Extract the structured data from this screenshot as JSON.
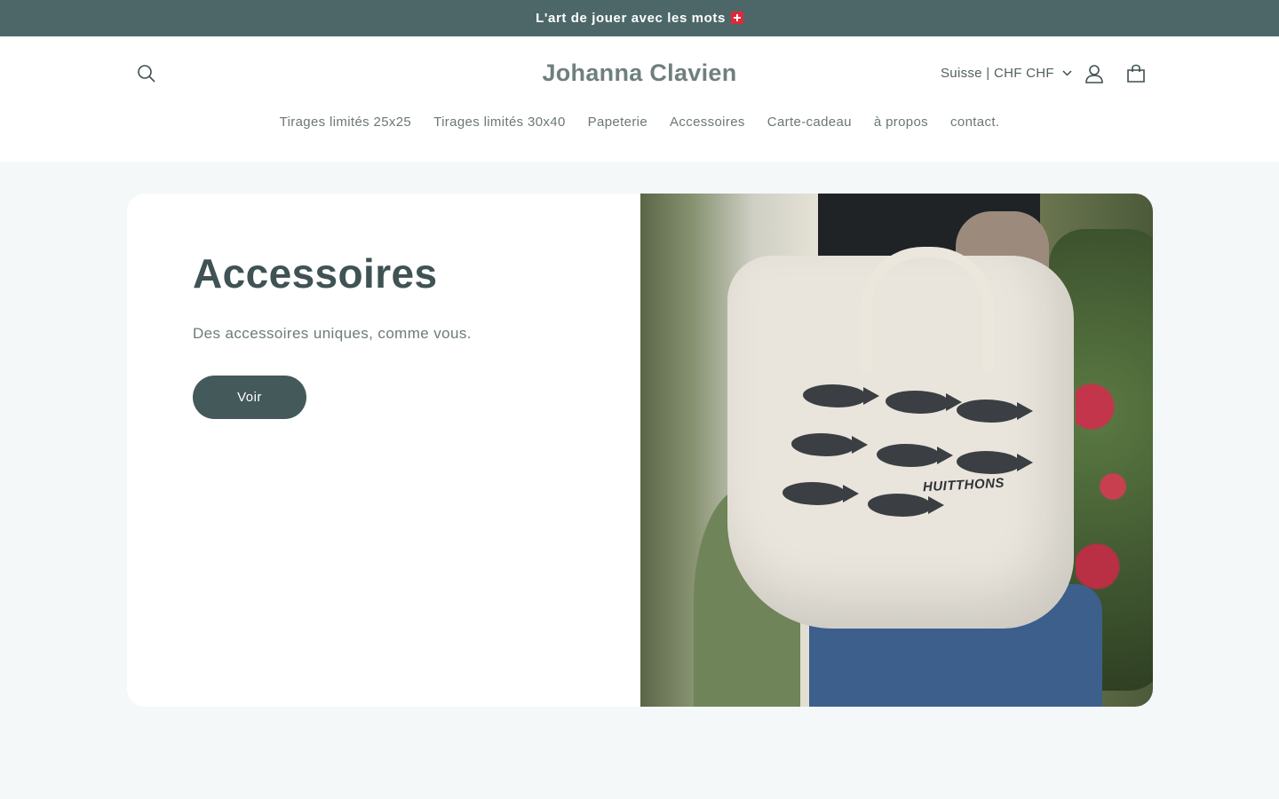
{
  "announcement": {
    "text": "L'art de jouer avec les mots",
    "flag_icon": "swiss-flag-icon"
  },
  "header": {
    "logo": "Johanna Clavien",
    "locale": "Suisse | CHF CHF",
    "icons": [
      "search-icon",
      "chevron-down-icon",
      "account-icon",
      "cart-icon"
    ]
  },
  "nav": {
    "items": [
      {
        "label": "Tirages limités 25x25"
      },
      {
        "label": "Tirages limités 30x40"
      },
      {
        "label": "Papeterie"
      },
      {
        "label": "Accessoires"
      },
      {
        "label": "Carte-cadeau"
      },
      {
        "label": "à propos"
      },
      {
        "label": "contact."
      }
    ]
  },
  "banner": {
    "title": "Accessoires",
    "subtitle": "Des accessoires uniques, comme vous.",
    "button_label": "Voir",
    "image_print_text": "HUITTHONS"
  },
  "colors": {
    "announcement_bg": "#4d6769",
    "page_bg": "#f4f8f8",
    "button_bg": "#44595a",
    "title": "#3f5254"
  }
}
